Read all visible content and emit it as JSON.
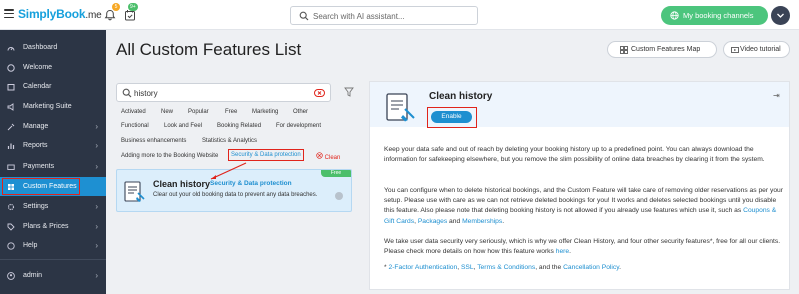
{
  "topbar": {
    "logo_main": "SimplyBook",
    "logo_suffix": ".me",
    "notif_count": "5",
    "calendar_badge": "9+",
    "search_placeholder": "Search with AI assistant...",
    "booking_channels": "My booking channels"
  },
  "sidebar": {
    "items": [
      {
        "label": "Dashboard",
        "icon": "dashboard-icon",
        "arrow": false
      },
      {
        "label": "Welcome",
        "icon": "welcome-icon",
        "arrow": false
      },
      {
        "label": "Calendar",
        "icon": "calendar-icon",
        "arrow": false
      },
      {
        "label": "Marketing Suite",
        "icon": "marketing-icon",
        "arrow": false
      },
      {
        "label": "Manage",
        "icon": "manage-icon",
        "arrow": true
      },
      {
        "label": "Reports",
        "icon": "reports-icon",
        "arrow": true
      },
      {
        "label": "Payments",
        "icon": "payments-icon",
        "arrow": true
      },
      {
        "label": "Custom Features",
        "icon": "custom-features-icon",
        "arrow": false,
        "active": true
      },
      {
        "label": "Settings",
        "icon": "settings-icon",
        "arrow": true
      },
      {
        "label": "Plans & Prices",
        "icon": "plans-icon",
        "arrow": true
      },
      {
        "label": "Help",
        "icon": "help-icon",
        "arrow": true
      }
    ],
    "user": "admin"
  },
  "main": {
    "title": "All Custom Features List",
    "map_button": "Custom Features Map",
    "video_button": "Video tutorial"
  },
  "filter": {
    "search_value": "history",
    "tags_row1": [
      "Activated",
      "New",
      "Popular",
      "Free",
      "Marketing",
      "Other"
    ],
    "tags_row2": [
      "Functional",
      "Look and Feel",
      "Booking Related",
      "For development"
    ],
    "tags_row3": [
      "Business enhancements",
      "Statistics & Analytics"
    ],
    "tags_row4": [
      "Adding more to the Booking Website",
      "Security & Data protection"
    ],
    "clean_label": "Clean"
  },
  "card": {
    "badge": "Free",
    "title": "Clean history",
    "category": "Security & Data protection",
    "description": "Clear out your old booking data to prevent any data breaches."
  },
  "detail": {
    "title": "Clean history",
    "enable": "Enable",
    "p1": "Keep your data safe and out of reach by deleting your booking history up to a predefined point. You can always download the information for safekeeping elsewhere, but you remove the slim possibility of online data breaches by clearing it from the system.",
    "p2_a": "You can configure when to delete historical bookings, and the Custom Feature will take care of removing older reservations as per your setup. Please use with care as we can not retrieve deleted bookings for you! It works and deletes selected bookings until you disable this feature. Also please note that deleting booking history is not allowed if you already use features which use it, such as ",
    "p2_link1": "Coupons & Gift Cards",
    "p2_sep": ", ",
    "p2_link2": "Packages",
    "p2_and": " and ",
    "p2_link3": "Memberships",
    "p2_end": ".",
    "p3_a": "We take user data security very seriously, which is why we offer Clean History, and four other security features*, free for all our clients. Please check more details on how how this feature works ",
    "p3_link": "here",
    "p3_end": ".",
    "p4_a": "* ",
    "p4_l1": "2-Factor Authentication",
    "p4_s1": ", ",
    "p4_l2": "SSL",
    "p4_s2": ", ",
    "p4_l3": "Terms & Conditions",
    "p4_s3": ", and the ",
    "p4_l4": "Cancellation Policy",
    "p4_end": "."
  },
  "colors": {
    "brand": "#16a0dc",
    "sidebar_bg": "#2c3545",
    "active": "#1e90d2",
    "green": "#4cc57d",
    "annotation": "#e0241b"
  }
}
